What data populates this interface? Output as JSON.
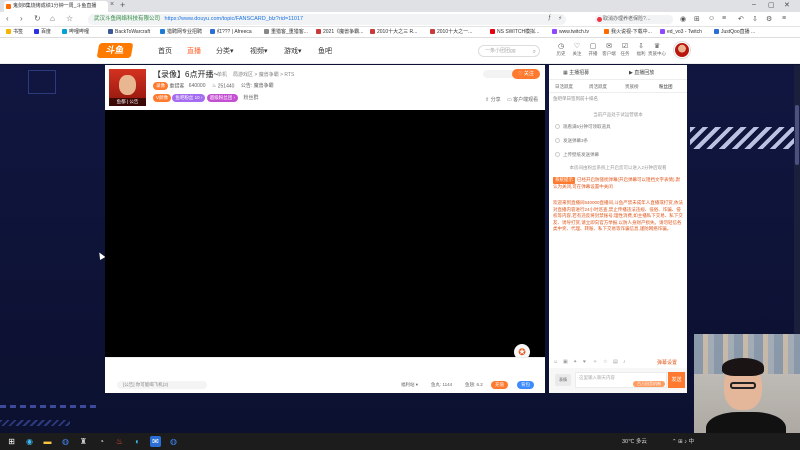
{
  "browser": {
    "tab_title": "鬼剑8集烧烤成绩1分钟一周_斗鱼直播",
    "address_site": "武汉斗鱼网络科技有限公司",
    "address_url": "https://www.douyu.com/topic/FANSCARD_blz?rid=11017",
    "search_text": "取消办理养老保险?…",
    "bookmarks": [
      {
        "label": "书签",
        "color": "#f5b400"
      },
      {
        "label": "百度",
        "color": "#2932e1"
      },
      {
        "label": "哔哩哔哩",
        "color": "#00a1d6"
      },
      {
        "label": "BackToWarcraft",
        "color": "#3b5998"
      },
      {
        "label": "猎聘网专业招聘",
        "color": "#1d7bd8"
      },
      {
        "label": "红??? | Afreeca",
        "color": "#2b6fd6"
      },
      {
        "label": "重猎客_重猎客...",
        "color": "#888888"
      },
      {
        "label": "2021《魔兽争霸...",
        "color": "#c93a3a"
      },
      {
        "label": "2010十大之三 R...",
        "color": "#c93a3a"
      },
      {
        "label": "2010十大之一...",
        "color": "#c93a3a"
      },
      {
        "label": "NS SWITCH模拟...",
        "color": "#e60012"
      },
      {
        "label": "www.twitch.tv",
        "color": "#9146ff"
      },
      {
        "label": "我火说视-下载中...",
        "color": "#ff6a00"
      },
      {
        "label": "ed_vo3 - Twitch",
        "color": "#9146ff"
      },
      {
        "label": "JustQoo直播 ...",
        "color": "#2b6fd6"
      }
    ]
  },
  "header": {
    "logo": "斗鱼",
    "nav": [
      "首页",
      "直播",
      "分类",
      "视频",
      "游戏",
      "鱼吧"
    ],
    "active_nav": "直播",
    "search_placeholder": "一条小团团gg",
    "tools": [
      {
        "icon": "history-icon",
        "glyph": "◷",
        "label": "历史"
      },
      {
        "icon": "follow-icon",
        "glyph": "♡",
        "label": "关注"
      },
      {
        "icon": "live-icon",
        "glyph": "▢",
        "label": "开播"
      },
      {
        "icon": "message-icon",
        "glyph": "✉",
        "label": "客户端"
      },
      {
        "icon": "task-icon",
        "glyph": "☑",
        "label": "任务"
      },
      {
        "icon": "download-icon",
        "glyph": "⇩",
        "label": "福利"
      },
      {
        "icon": "vip-icon",
        "glyph": "♛",
        "label": "贵族中心"
      }
    ]
  },
  "room": {
    "title": "【录像】6点开播~",
    "category_1": "单机",
    "category_2": "局游戏区 > 魔兽争霸 > RTS",
    "anchor_tag": "录像",
    "anchor_name": "重猎客",
    "room_id": "640000",
    "hot": "251440",
    "report": "公告: 魔兽争霸",
    "avatar_caption": "鱼都 | 公告",
    "badges": [
      {
        "text": "V颜像",
        "color": "#ff7a2e"
      },
      {
        "text": "鱼吧粉丝 10 ›",
        "color": "#a46cf0"
      },
      {
        "text": "超级粉丝团 ›",
        "color": "#c44fd3"
      }
    ],
    "fans_label": "粉丝群",
    "follow_label": "关注",
    "share_label": "分享",
    "client_label": "客户端观看",
    "video_icon": "✪"
  },
  "player_footer": {
    "danmu_placeholder": "[公告] 你可能喝飞机(2)",
    "items": [
      "福利站 ▾",
      "鱼丸: 1144",
      "鱼翅: 6.2"
    ],
    "btn_1": "充值",
    "btn_2": "背包"
  },
  "chat": {
    "top_left": "主播招募",
    "top_right": "直播回放",
    "tabs": [
      "日活跃度",
      "周活跃度",
      "贵族榜",
      "粉丝团"
    ],
    "sub": "鱼吧单日签到前十排名",
    "notice_1": "当前产品处于试运营版本",
    "tasks": [
      "观看满5分钟可领取道具",
      "发送弹幕3条",
      "上传壁纸发送弹幕"
    ],
    "notice_2": "本房间由粉丝系统上开启您可以进入2分钟后观看",
    "sys_label": "系统提示",
    "sys_1": "已经开启防骚扰弹幕(开启弹幕可以阻挡文字表情),默认为关闭,可在弹幕设置中关闭",
    "sys_2": "欢迎来到直播间540000直播间,斗鱼严禁未成年人直播或打赏,依法对直播内容进行24小时巡查,禁止传播违法违规、低俗、诈骗、侵权等内容,若有违反将封禁账号;理性消费,如主播私下交易、私下交友、诱导打赏,请立即向官方举报,以防人身财产损失。请勿轻信各类中奖、代理、转账、私下交易等诈骗信息,谨防网络诈骗。",
    "input_placeholder": "这里输入聊天内容",
    "gift_btn": "百万回音机制",
    "send_label": "发送",
    "emoji_label": "表情",
    "tool_right": "弹幕设置"
  },
  "taskbar": {
    "weather": "30℃ 多云",
    "tray": "⌃ ⊞ ♪ 中",
    "icons": [
      {
        "name": "windows-start-icon",
        "glyph": "⊞",
        "color": "#ffffff",
        "bg": "#1c1c1c"
      },
      {
        "name": "edge-icon",
        "glyph": "◉",
        "color": "#3dbaf2",
        "bg": "#1c1c1c"
      },
      {
        "name": "folder-icon",
        "glyph": "▬",
        "color": "#f5c542",
        "bg": "#1c1c1c"
      },
      {
        "name": "chrome-icon",
        "glyph": "◍",
        "color": "#4285f4",
        "bg": "#1c1c1c"
      },
      {
        "name": "sword-icon",
        "glyph": "♜",
        "color": "#cccccc",
        "bg": "#1c1c1c"
      },
      {
        "name": "clock-icon",
        "glyph": "◔",
        "color": "#cccccc",
        "bg": "#1c1c1c"
      },
      {
        "name": "fire-icon",
        "glyph": "♨",
        "color": "#ff5a36",
        "bg": "#1c1c1c"
      },
      {
        "name": "globe-icon",
        "glyph": "◐",
        "color": "#36c1e8",
        "bg": "#1c1c1c"
      },
      {
        "name": "mail-icon",
        "glyph": "✉",
        "color": "#ffffff",
        "bg": "#2b6fd6"
      },
      {
        "name": "chrome-2-icon",
        "glyph": "◍",
        "color": "#4285f4",
        "bg": "#1c1c1c"
      }
    ]
  }
}
